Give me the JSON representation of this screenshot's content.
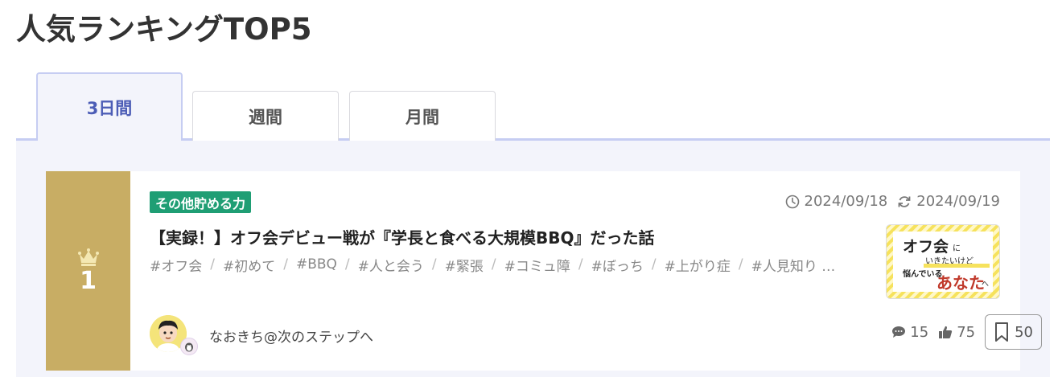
{
  "page": {
    "title": "人気ランキングTOP5"
  },
  "tabs": [
    {
      "label": "3日間",
      "active": true
    },
    {
      "label": "週間",
      "active": false
    },
    {
      "label": "月間",
      "active": false
    }
  ],
  "colors": {
    "accent": "#4c5db6",
    "rank_gold": "#c8ad64",
    "category_green": "#1f9e74",
    "panel_bg": "#f3f4fb"
  },
  "ranking": [
    {
      "rank": "1",
      "category": "その他貯める力",
      "published": "2024/09/18",
      "updated": "2024/09/19",
      "title": "【実録！】オフ会デビュー戦が『学長と食べる大規模BBQ』だった話",
      "tags": [
        "#オフ会",
        "#初めて",
        "#BBQ",
        "#人と会う",
        "#緊張",
        "#コミュ障",
        "#ぼっち",
        "#上がり症",
        "#人見知り …"
      ],
      "thumbnail": {
        "line1": "オフ会",
        "line1_suffix": "に",
        "line2": "いきたいけど",
        "line3": "悩んでいる",
        "line4": "あなた",
        "line4_suffix": "へ"
      },
      "author": {
        "name": "なおきち@次のステップへ"
      },
      "stats": {
        "comments": "15",
        "likes": "75",
        "bookmarks": "50"
      },
      "icons": {
        "crown": "crown-icon",
        "published": "clock-icon",
        "updated": "refresh-icon",
        "comments": "comment-icon",
        "likes": "thumbs-up-icon",
        "bookmarks": "bookmark-icon"
      }
    }
  ]
}
